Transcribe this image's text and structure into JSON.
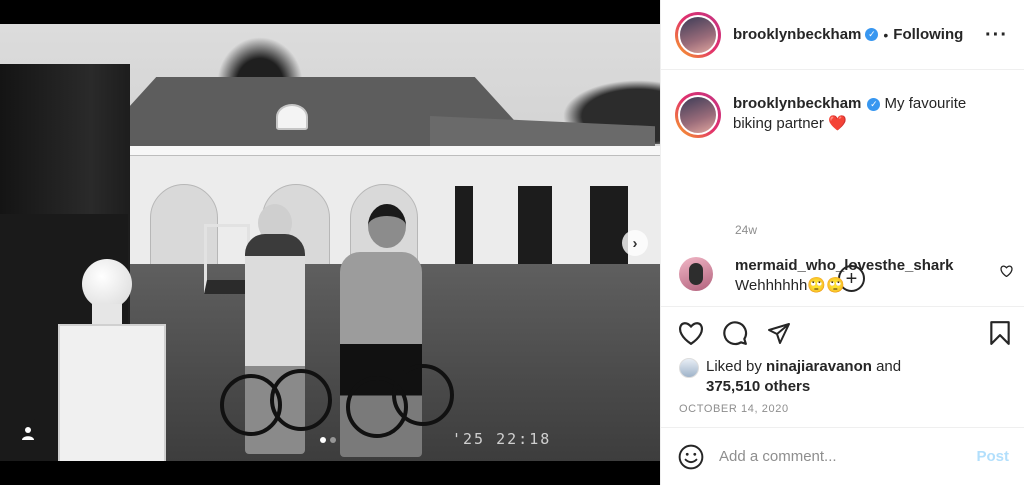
{
  "post": {
    "author": "brooklynbeckham",
    "follow_status": "Following",
    "caption": "My favourite biking partner",
    "caption_emoji": "❤️",
    "age": "24w",
    "photo_timestamp": "'25 22:18",
    "carousel": {
      "count": 2,
      "active_index": 0
    }
  },
  "comment": {
    "author": "mermaid_who_lovesthe_shark",
    "text": "Wehhhhhh🙄🙄"
  },
  "likes": {
    "prefix": "Liked by",
    "user": "ninajiaravanon",
    "and": "and",
    "others": "375,510 others"
  },
  "date": "OCTOBER 14, 2020",
  "add_comment": {
    "placeholder": "Add a comment...",
    "post_label": "Post"
  },
  "icons": {
    "verified": "verified-badge-icon",
    "more": "more-options-icon",
    "heart": "heart-icon",
    "comment": "comment-icon",
    "share": "share-icon",
    "save": "bookmark-icon",
    "emoji": "emoji-icon",
    "add": "plus-circle-icon",
    "next": "chevron-right-icon",
    "tag": "user-tag-icon"
  },
  "colors": {
    "verified": "#3897f0",
    "post_disabled": "#b2dffc",
    "muted": "#8e8e8e"
  }
}
